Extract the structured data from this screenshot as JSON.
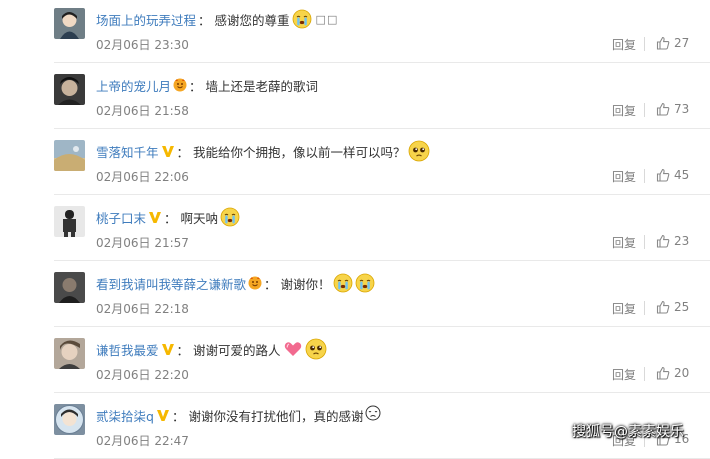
{
  "comments": [
    {
      "username": "场面上的玩弄过程",
      "text": "感谢您的尊重",
      "badge": "",
      "emojis": [
        "crying-face-icon"
      ],
      "extra": "□□",
      "time": "02月06日 23:30",
      "reply_label": "回复",
      "likes": "27",
      "avatar_color": "#6f7e86"
    },
    {
      "username": "上帝的宠儿月",
      "text": "墙上还是老薛的歌词",
      "badge": "orange-vip-badge",
      "emojis": [],
      "extra": "",
      "time": "02月06日 21:58",
      "reply_label": "回复",
      "likes": "73",
      "avatar_color": "#3a3a3a"
    },
    {
      "username": "雪落知千年",
      "text": "我能给你个拥抱，像以前一样可以吗？",
      "badge": "yellow-v-badge",
      "emojis": [
        "pleading-face-icon"
      ],
      "extra": "",
      "time": "02月06日 22:06",
      "reply_label": "回复",
      "likes": "45",
      "avatar_color": "#9fb6c6"
    },
    {
      "username": "桃子口末",
      "text": "啊天呐",
      "badge": "yellow-v-badge",
      "emojis": [
        "crying-face-icon"
      ],
      "extra": "",
      "time": "02月06日 21:57",
      "reply_label": "回复",
      "likes": "23",
      "avatar_color": "#e8e8e8"
    },
    {
      "username": "看到我请叫我等薛之谦新歌",
      "text": "谢谢你！",
      "badge": "orange-vip-badge",
      "emojis": [
        "crying-face-icon",
        "crying-face-icon"
      ],
      "extra": "",
      "time": "02月06日 22:18",
      "reply_label": "回复",
      "likes": "25",
      "avatar_color": "#4a4a4a"
    },
    {
      "username": "谦哲我最爱",
      "text": "谢谢可爱的路人",
      "badge": "yellow-v-badge",
      "emojis": [
        "heart-icon",
        "pleading-face-icon"
      ],
      "extra": "",
      "time": "02月06日 22:20",
      "reply_label": "回复",
      "likes": "20",
      "avatar_color": "#b3a79a"
    },
    {
      "username": "贰柒拾柒q",
      "text": "谢谢你没有打扰他们，真的感谢",
      "badge": "yellow-v-badge",
      "emojis": [
        "crying-small-icon"
      ],
      "extra": "",
      "time": "02月06日 22:47",
      "reply_label": "回复",
      "likes": "16",
      "avatar_color": "#7d8fa0"
    }
  ],
  "watermark": "搜狐号@素素娱乐",
  "colors": {
    "username": "#3f7cbd",
    "meta": "#808080",
    "vip_orange": "#f5a623",
    "v_yellow": "#f6b800"
  }
}
